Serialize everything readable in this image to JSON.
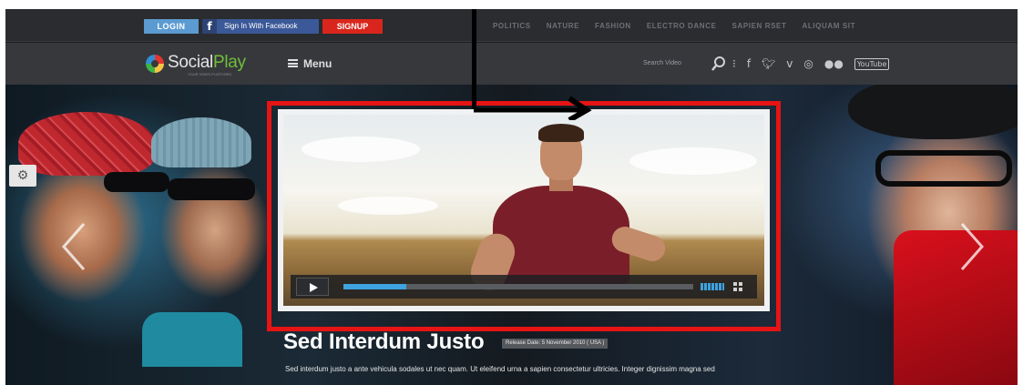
{
  "topbar": {
    "login_label": "LOGIN",
    "facebook_label": "Sign In With Facebook",
    "signup_label": "SIGNUP",
    "nav": [
      "POLITICS",
      "NATURE",
      "FASHION",
      "ELECTRO DANCE",
      "SAPIEN RSET",
      "ALIQUAM SIT"
    ]
  },
  "header": {
    "logo_text_a": "Social",
    "logo_text_b": "Play",
    "logo_tagline": "YOUR VIDEO PLATFORM",
    "menu_label": "Menu",
    "search_label": "Search Video",
    "social_icons": [
      "facebook-icon",
      "twitter-icon",
      "vimeo-icon",
      "dribbble-icon",
      "flickr-icon",
      "youtube-icon"
    ],
    "youtube_label": "YouTube"
  },
  "hero": {
    "video": {
      "progress": 0.18,
      "volume_level": 1.0
    },
    "title": "Sed Interdum Justo",
    "release_badge": "Release Date: 5 November 2010 ( USA )",
    "description": "Sed interdum justo a ante vehicula sodales ut nec quam. Ut eleifend urna a sapien consectetur ultricies. Integer dignissim magna sed"
  },
  "colors": {
    "highlight": "#e61414",
    "login": "#5b9bd1",
    "facebook": "#3b5998",
    "signup": "#d9261c",
    "progress": "#3ea3e0"
  }
}
